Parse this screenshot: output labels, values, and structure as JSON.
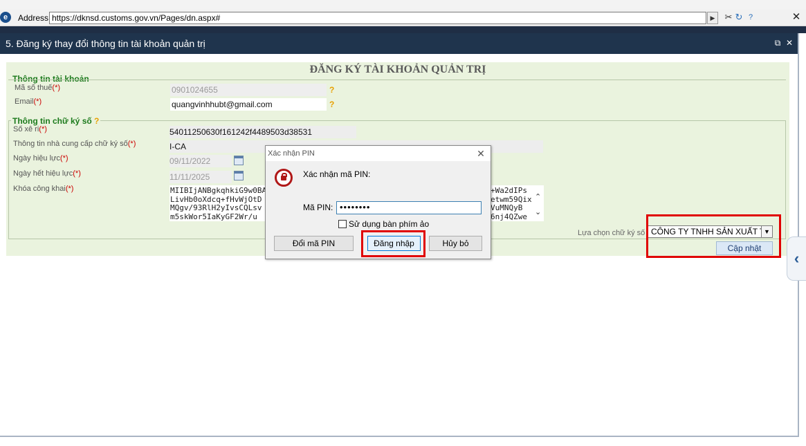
{
  "browser": {
    "address_label": "Address:",
    "url": "https://dknsd.customs.gov.vn/Pages/dn.aspx#"
  },
  "panel": {
    "title": "5. Đăng ký thay đổi thông tin tài khoản quản trị"
  },
  "form": {
    "heading": "ĐĂNG KÝ TÀI KHOẢN QUẢN TRỊ",
    "account_section": {
      "legend": "Thông tin tài khoản",
      "tax_code_label": "Mã số thuế",
      "tax_code_value": "0901024655",
      "email_label": "Email",
      "email_value": "quangvinhhubt@gmail.com",
      "help_mark": "?"
    },
    "signature_section": {
      "legend": "Thông tin chữ ký số",
      "serial_label": "Số xê ri",
      "serial_value": "54011250630f161242f4489503d38531",
      "provider_label": "Thông tin nhà cung cấp chữ ký số",
      "provider_value": "I-CA",
      "valid_from_label": "Ngày hiệu lực",
      "valid_from_value": "09/11/2022",
      "valid_to_label": "Ngày hết hiệu lực",
      "valid_to_value": "11/11/2025",
      "public_key_label": "Khóa công khai",
      "public_key_lines": [
        "MIIBIjANBgkqhkiG9w0BA",
        "LivHb0oXdcq+fHvWjOtD",
        "MQgv/93RlH2yIvsCQLsv",
        "m5skWor5IaKyGF2Wr/u"
      ],
      "public_key_lines_right": [
        "+Wa2dIPs",
        "etwm59Qix",
        "VuMNQyB",
        "6nj4QZwe"
      ],
      "select_label": "Lựa chọn chữ ký số",
      "select_value": "CÔNG TY TNHH SẢN XUẤT TH"
    },
    "required_mark": "(*)",
    "update_button": "Cập nhật"
  },
  "pin_dialog": {
    "title": "Xác nhận PIN",
    "prompt": "Xác nhận mã PIN:",
    "pin_label": "Mã PIN:",
    "pin_value": "••••••••",
    "virtual_keyboard_label": "Sử dụng bàn phím ảo",
    "change_pin_button": "Đổi mã PIN",
    "login_button": "Đăng nhập",
    "cancel_button": "Hủy bỏ"
  },
  "colors": {
    "title_bar": "#1f344d",
    "form_bg": "#eaf3de",
    "legend": "#1c7a1c",
    "required": "#cc0000",
    "highlight": "#e00000"
  }
}
